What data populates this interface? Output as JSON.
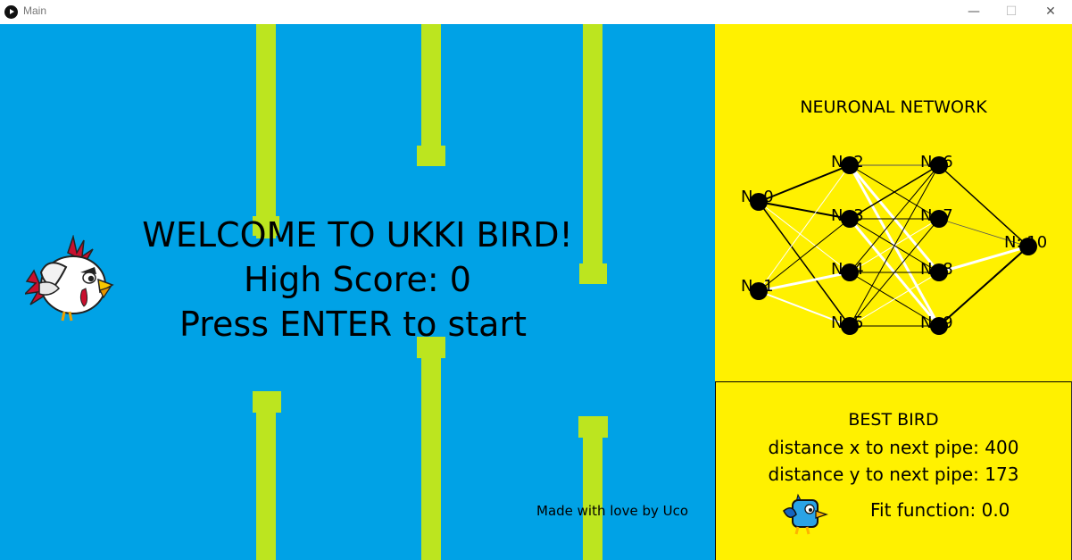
{
  "window": {
    "title": "Main",
    "minimize_glyph": "—",
    "maximize_glyph": "☐",
    "close_glyph": "✕"
  },
  "game": {
    "background_color": "#00a2e6",
    "pipe_color": "#bce51f",
    "welcome_title": "WELCOME TO UKKI BIRD!",
    "high_score_text": "High Score: 0",
    "start_prompt": "Press ENTER to start",
    "credit": "Made with love by Uco"
  },
  "network_panel": {
    "title": "NEURONAL NETWORK",
    "background_color": "#fff100",
    "nodes": [
      "N: 0",
      "N: 1",
      "N: 2",
      "N: 3",
      "N: 4",
      "N: 5",
      "N: 6",
      "N: 7",
      "N: 8",
      "N: 9",
      "N: 10"
    ]
  },
  "best_bird": {
    "title": "BEST BIRD",
    "distance_x": "distance x to next pipe: 400",
    "distance_y": "distance y to next pipe: 173",
    "fit_function": "Fit function: 0.0"
  }
}
